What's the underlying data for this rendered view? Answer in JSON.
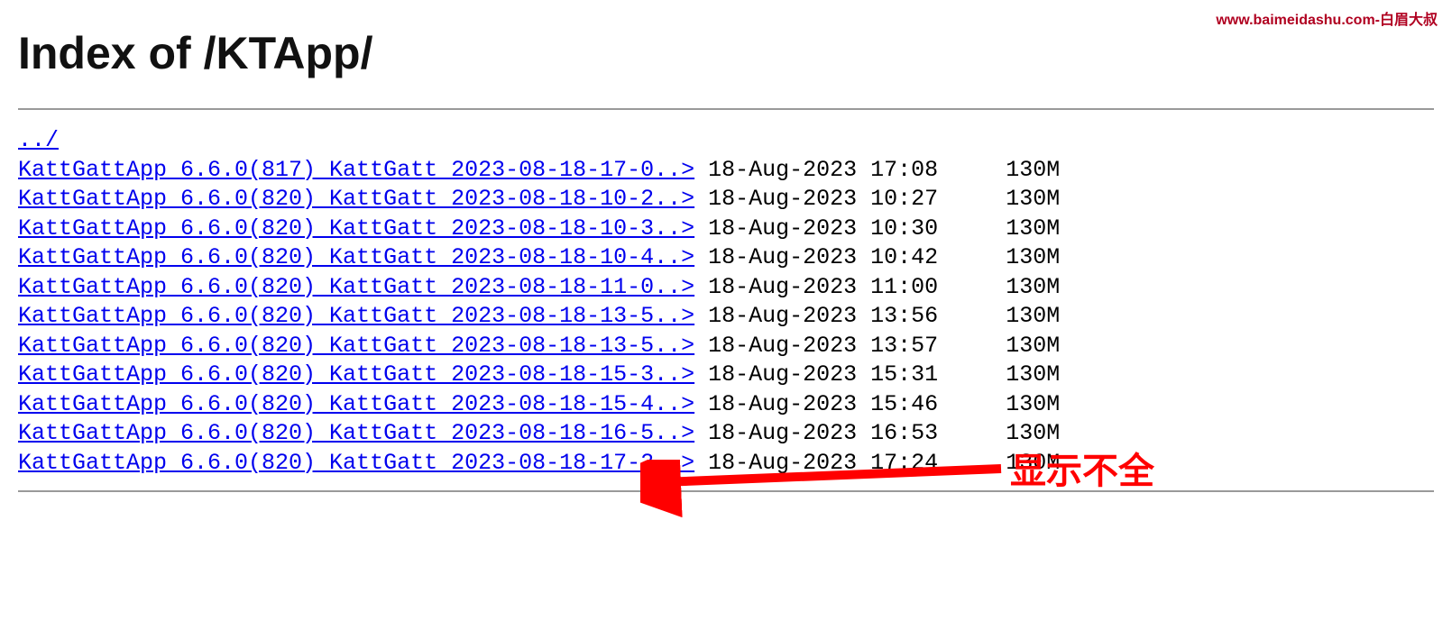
{
  "watermark": "www.baimeidashu.com-白眉大叔",
  "heading": "Index of /KTApp/",
  "parent_link": "../",
  "files": [
    {
      "name": "KattGattApp 6.6.0(817) KattGatt 2023-08-18-17-0..>",
      "date": "18-Aug-2023 17:08",
      "size": "130M"
    },
    {
      "name": "KattGattApp 6.6.0(820) KattGatt 2023-08-18-10-2..>",
      "date": "18-Aug-2023 10:27",
      "size": "130M"
    },
    {
      "name": "KattGattApp 6.6.0(820) KattGatt 2023-08-18-10-3..>",
      "date": "18-Aug-2023 10:30",
      "size": "130M"
    },
    {
      "name": "KattGattApp 6.6.0(820) KattGatt 2023-08-18-10-4..>",
      "date": "18-Aug-2023 10:42",
      "size": "130M"
    },
    {
      "name": "KattGattApp 6.6.0(820) KattGatt 2023-08-18-11-0..>",
      "date": "18-Aug-2023 11:00",
      "size": "130M"
    },
    {
      "name": "KattGattApp 6.6.0(820) KattGatt 2023-08-18-13-5..>",
      "date": "18-Aug-2023 13:56",
      "size": "130M"
    },
    {
      "name": "KattGattApp 6.6.0(820) KattGatt 2023-08-18-13-5..>",
      "date": "18-Aug-2023 13:57",
      "size": "130M"
    },
    {
      "name": "KattGattApp 6.6.0(820) KattGatt 2023-08-18-15-3..>",
      "date": "18-Aug-2023 15:31",
      "size": "130M"
    },
    {
      "name": "KattGattApp 6.6.0(820) KattGatt 2023-08-18-15-4..>",
      "date": "18-Aug-2023 15:46",
      "size": "130M"
    },
    {
      "name": "KattGattApp 6.6.0(820) KattGatt 2023-08-18-16-5..>",
      "date": "18-Aug-2023 16:53",
      "size": "130M"
    },
    {
      "name": "KattGattApp 6.6.0(820) KattGatt 2023-08-18-17-2..>",
      "date": "18-Aug-2023 17:24",
      "size": "130M"
    }
  ],
  "annotation": "显示不全"
}
